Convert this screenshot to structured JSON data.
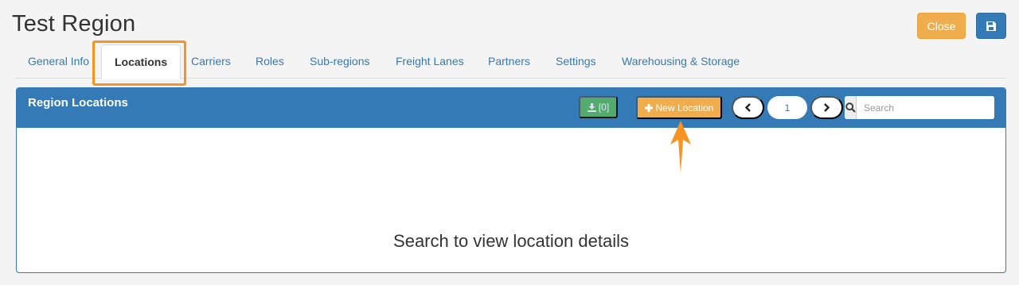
{
  "header": {
    "title": "Test Region",
    "close_label": "Close",
    "save_icon": "floppy-disk-icon"
  },
  "tabs": [
    {
      "label": "General Info",
      "active": false
    },
    {
      "label": "Locations",
      "active": true
    },
    {
      "label": "Carriers",
      "active": false
    },
    {
      "label": "Roles",
      "active": false
    },
    {
      "label": "Sub-regions",
      "active": false
    },
    {
      "label": "Freight Lanes",
      "active": false
    },
    {
      "label": "Partners",
      "active": false
    },
    {
      "label": "Settings",
      "active": false
    },
    {
      "label": "Warehousing & Storage",
      "active": false
    }
  ],
  "panel": {
    "title": "Region Locations",
    "export_label": "[0]",
    "new_location_label": "New Location",
    "pager": {
      "page": "1"
    },
    "search": {
      "placeholder": "Search",
      "value": ""
    },
    "empty_message": "Search to view location details"
  },
  "colors": {
    "primary": "#337ab7",
    "warning": "#f0ad4e",
    "success": "#5cb85c",
    "annotation": "#f7931e"
  }
}
